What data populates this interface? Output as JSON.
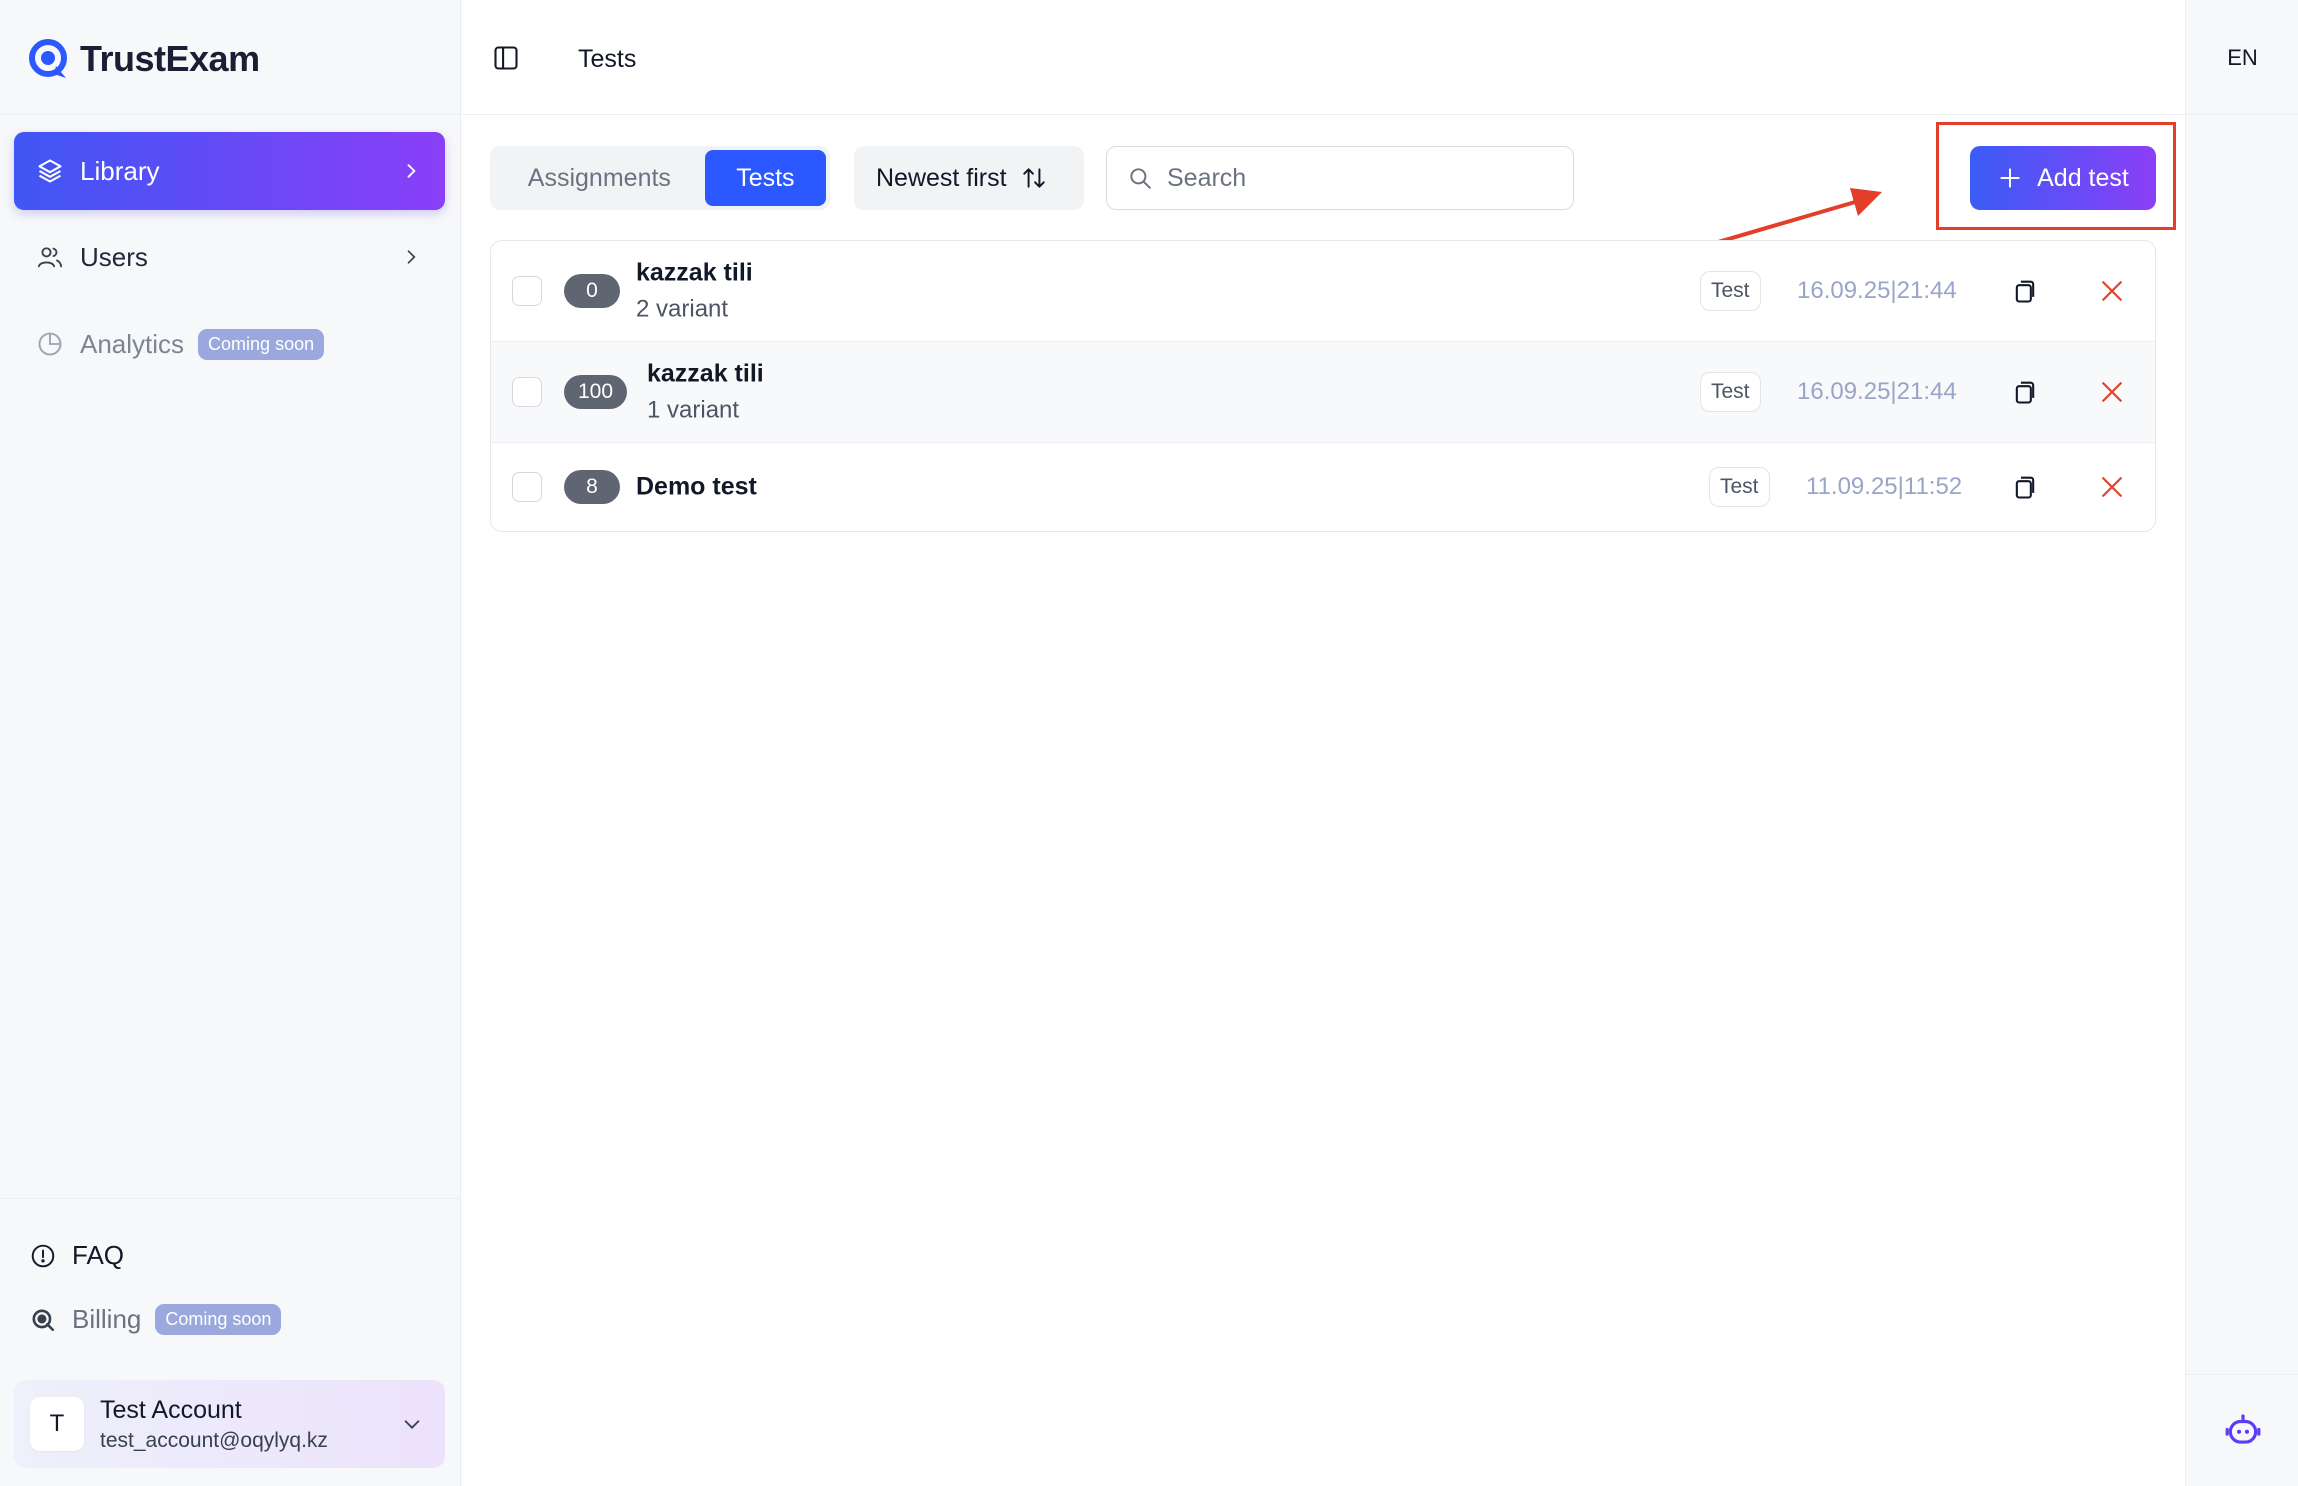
{
  "app": {
    "name": "TrustExam",
    "accent": "#2b59ff",
    "gradient_from": "#3f56f5",
    "gradient_to": "#8a3ff7"
  },
  "sidebar": {
    "items": [
      {
        "label": "Library",
        "icon": "layers-icon",
        "active": true
      },
      {
        "label": "Users",
        "icon": "users-icon",
        "active": false
      },
      {
        "label": "Analytics",
        "icon": "pie-chart-icon",
        "badge": "Coming soon",
        "disabled": true
      }
    ],
    "bottom": [
      {
        "label": "FAQ",
        "icon": "info-icon"
      },
      {
        "label": "Billing",
        "icon": "billing-icon",
        "badge": "Coming soon",
        "disabled": true
      }
    ],
    "account": {
      "initial": "T",
      "name": "Test Account",
      "email": "test_account@oqylyq.kz"
    }
  },
  "header": {
    "title": "Tests",
    "language": "EN"
  },
  "toolbar": {
    "tabs": [
      {
        "label": "Assignments",
        "active": false
      },
      {
        "label": "Tests",
        "active": true
      }
    ],
    "sort_label": "Newest first",
    "search_placeholder": "Search",
    "add_label": "Add test"
  },
  "tests": [
    {
      "count": "0",
      "name": "kazzak tili",
      "variants": "2 variant",
      "type": "Test",
      "date": "16.09.25|21:44"
    },
    {
      "count": "100",
      "name": "kazzak tili",
      "variants": "1 variant",
      "type": "Test",
      "date": "16.09.25|21:44"
    },
    {
      "count": "8",
      "name": "Demo test",
      "variants": "",
      "type": "Test",
      "date": "11.09.25|11:52"
    }
  ],
  "annotation": {
    "color": "#e23e2a"
  }
}
